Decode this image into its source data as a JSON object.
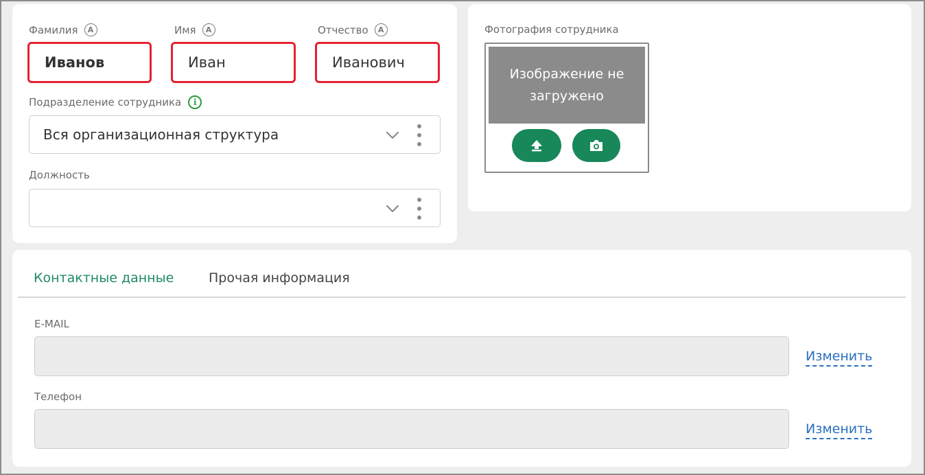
{
  "name_card": {
    "last_name": {
      "label": "Фамилия",
      "value": "Иванов",
      "badge": "A"
    },
    "first_name": {
      "label": "Имя",
      "value": "Иван",
      "badge": "A"
    },
    "middle_name": {
      "label": "Отчество",
      "value": "Иванович",
      "badge": "A"
    },
    "department": {
      "label": "Подразделение сотрудника",
      "info_glyph": "i",
      "value": "Вся организационная структура"
    },
    "position": {
      "label": "Должность",
      "value": ""
    }
  },
  "photo_card": {
    "label": "Фотография сотрудника",
    "placeholder": "Изображение не загружено",
    "upload_icon": "upload-icon",
    "camera_icon": "camera-icon"
  },
  "contacts_card": {
    "tabs": [
      {
        "label": "Контактные данные",
        "active": true
      },
      {
        "label": "Прочая информация",
        "active": false
      }
    ],
    "email": {
      "label": "E-MAIL",
      "value": "",
      "change_label": "Изменить"
    },
    "phone": {
      "label": "Телефон",
      "value": "",
      "change_label": "Изменить"
    }
  },
  "colors": {
    "error_border": "#e3222f",
    "accent_green": "#18875a",
    "active_tab": "#1f8a63",
    "link_blue": "#2a6fc1",
    "info_green": "#2e9a3c"
  }
}
